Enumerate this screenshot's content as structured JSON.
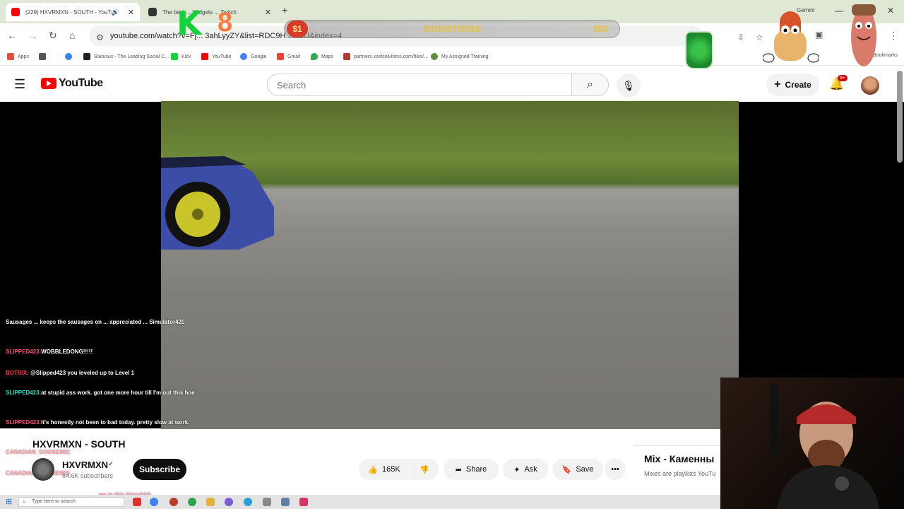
{
  "browser": {
    "tabs": [
      {
        "title": "(229) HXVRMXN - SOUTH - YouTube",
        "active": true
      },
      {
        "title": "The best ... Widgets ... Twitch",
        "active": false
      }
    ],
    "new_tab_label": "+",
    "url": "youtube.com/watch?v=Fj... 3ahLyyZY&list=RDC9H... xCU&index=4",
    "profile_label": "Gemini",
    "bookmarks": [
      "Apps",
      "Statusus - The Leading Social C...",
      "Kick",
      "YouTube",
      "Google",
      "Gmail",
      "Maps",
      "partners.xcelsolutions.com/files/...",
      "My Assigned Training"
    ],
    "bookmarks_end": "Bookmarks"
  },
  "youtube": {
    "logo_text": "YouTube",
    "search_placeholder": "Search",
    "create_label": "Create",
    "notifications_badge": "9+"
  },
  "video": {
    "title": "HXVRMXN - SOUTH",
    "channel": "HXVRMXN",
    "subscribers": "64.6K subscribers",
    "subscribe_label": "Subscribe",
    "likes": "165K",
    "share_label": "Share",
    "ask_label": "Ask",
    "save_label": "Save"
  },
  "mix": {
    "title": "Mix - Каменны",
    "subtitle": "Mixes are playlists YouTu"
  },
  "chat": [
    {
      "user": "",
      "text": "Sausages ... keeps the sausages on ... appreciated ... Simulator420"
    },
    {
      "user": "SLIPPED423:",
      "text": "WOBBLEDONG!!!!!"
    },
    {
      "user": "BOTRIX:",
      "text": "@Slipped423 you leveled up to Level 1"
    },
    {
      "user": "SLIPPED423:",
      "text": "at stupid ass work. got one more hour till I'm out this hoe"
    },
    {
      "user": "SLIPPED423:",
      "text": "It's honestly not been to bad today. pretty slow at work."
    },
    {
      "user": "CANADIAN_GOOSE902:",
      "text": ""
    },
    {
      "user": "CANADIAN_GOOSE902:",
      "text": ""
    },
    {
      "user": "",
      "text": "we in this bissshhh"
    }
  ],
  "overlay": {
    "donation_min": "$1",
    "donation_label": "DONATIONS",
    "donation_max": "$50",
    "k_letter": "K",
    "counter": "8"
  },
  "taskbar": {
    "search_placeholder": "Type here to search"
  },
  "colors": {
    "youtube_red": "#ff0000",
    "chrome_tabstrip": "#dfe8d4",
    "donation_gold": "#e8c23a",
    "kick_green": "#14d23a"
  }
}
